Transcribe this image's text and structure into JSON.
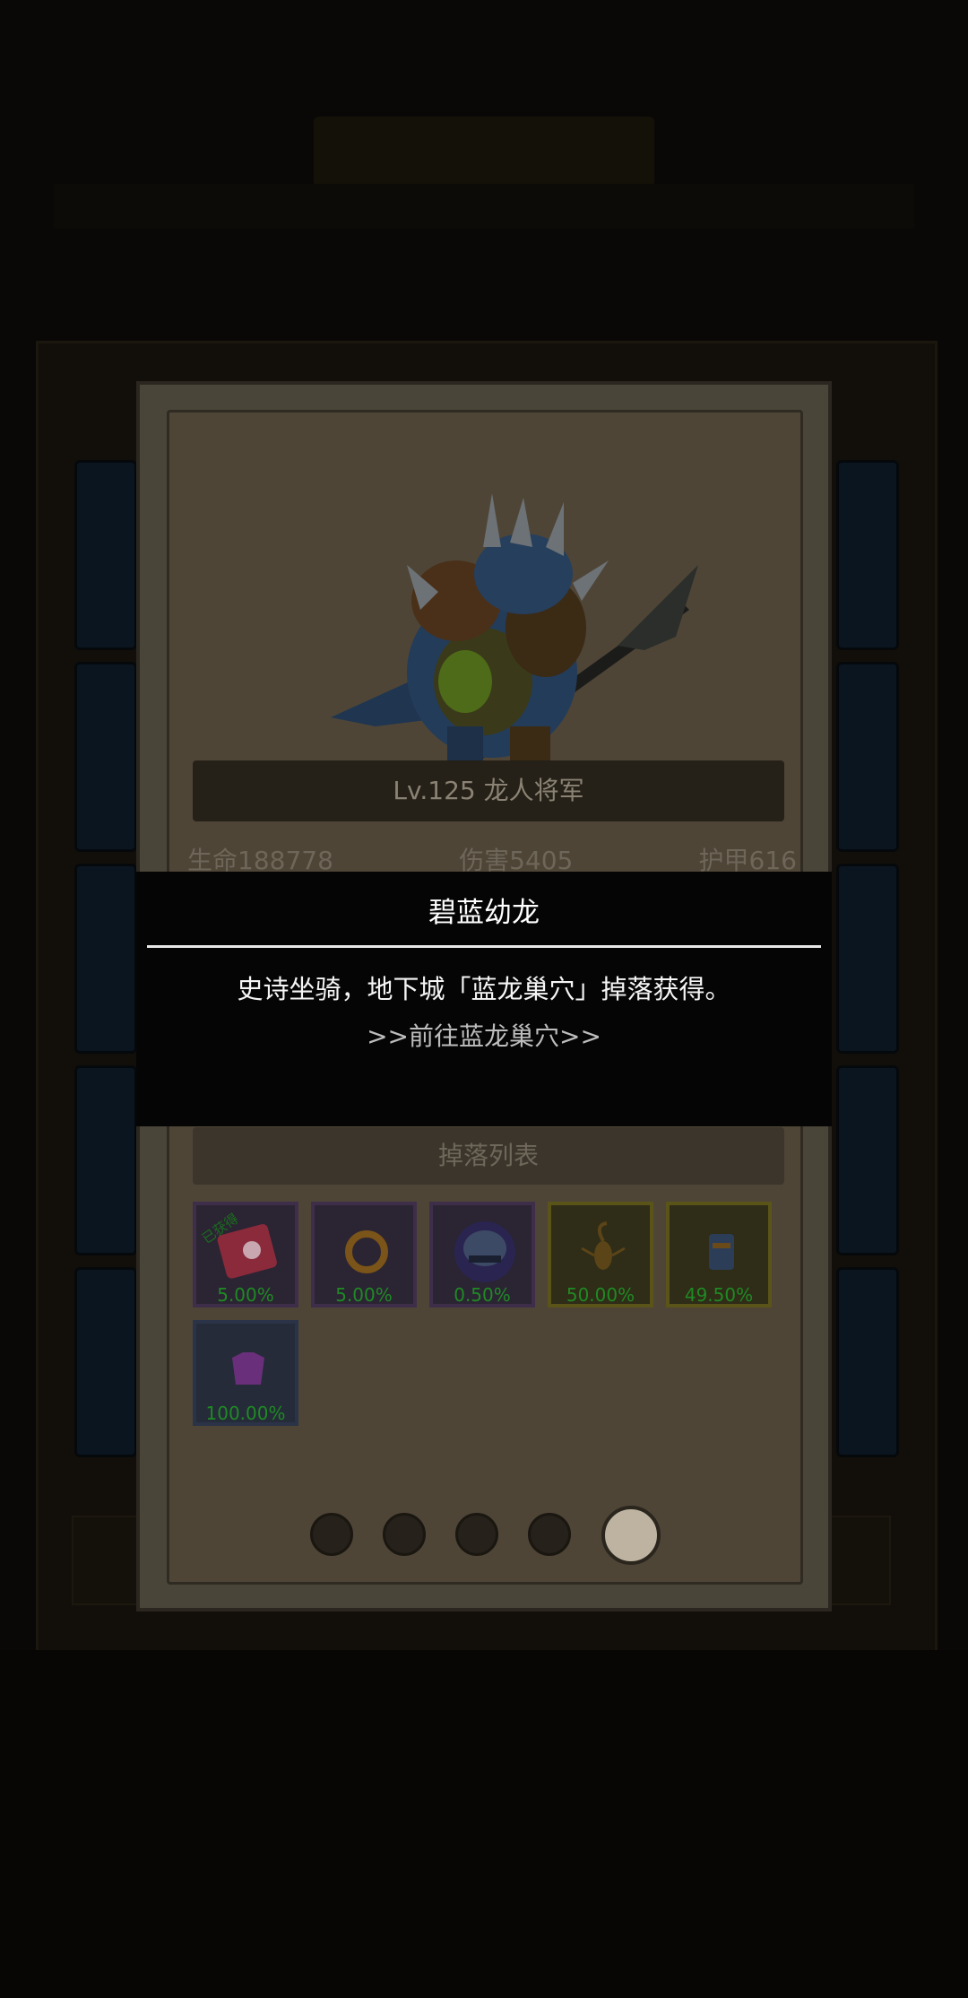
{
  "monster": {
    "name_label": "Lv.125 龙人将军",
    "stats": {
      "hp": "生命188778",
      "damage": "伤害5405",
      "armor": "护甲616"
    }
  },
  "drops": {
    "header": "掉落列表",
    "items": [
      {
        "icon": "red-book-icon",
        "percent": "5.00%",
        "badge": "已获得",
        "rarity": "purple"
      },
      {
        "icon": "gold-ring-icon",
        "percent": "5.00%",
        "badge": "",
        "rarity": "purple"
      },
      {
        "icon": "helmet-orb-icon",
        "percent": "0.50%",
        "badge": "",
        "rarity": "purple"
      },
      {
        "icon": "scorpion-icon",
        "percent": "50.00%",
        "badge": "",
        "rarity": "gold"
      },
      {
        "icon": "scroll-icon",
        "percent": "49.50%",
        "badge": "",
        "rarity": "gold"
      },
      {
        "icon": "purple-armor-icon",
        "percent": "100.00%",
        "badge": "",
        "rarity": "blue"
      }
    ]
  },
  "pager": {
    "count": 5,
    "active_index": 4
  },
  "tooltip": {
    "title": "碧蓝幼龙",
    "description": "史诗坐骑，地下城「蓝龙巢穴」掉落获得。",
    "link": ">>前往蓝龙巢穴>>"
  },
  "colors": {
    "drop_percent": "#1f8a24",
    "tooltip_bg": "#050505",
    "tooltip_text": "#ffffff"
  }
}
